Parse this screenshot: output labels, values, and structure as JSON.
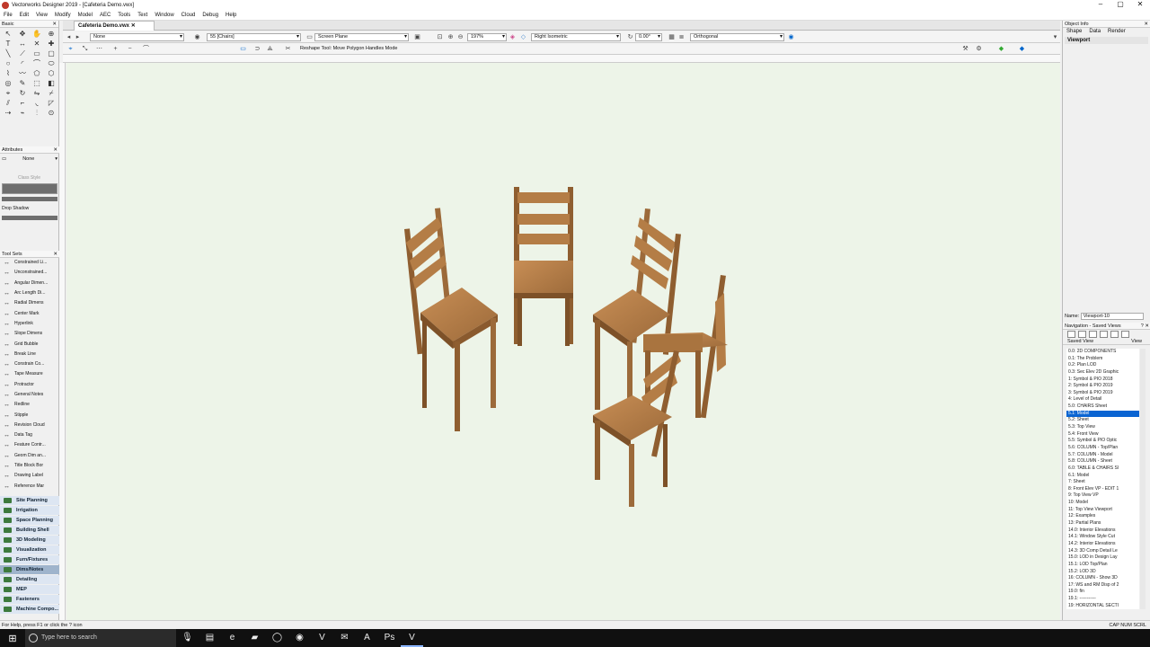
{
  "window": {
    "title": "Vectorworks Designer 2019 - [Cafeteria Demo.vwx]"
  },
  "menu": [
    "File",
    "Edit",
    "View",
    "Modify",
    "Model",
    "AEC",
    "Tools",
    "Text",
    "Window",
    "Cloud",
    "Debug",
    "Help"
  ],
  "document_tab": "Cafeteria Demo.vwx",
  "toolbar": {
    "class": "None",
    "layer": "55 [Chairs]",
    "plane": "Screen Plane",
    "zoom": "197%",
    "view": "Right Isometric",
    "rotation": "0.00°",
    "projection": "Orthogonal",
    "mode_hint": "Reshape Tool: Move Polygon Handles Mode"
  },
  "palettes": {
    "basic_title": "Basic",
    "attributes_title": "Attributes",
    "attributes_fill": "None",
    "class_style": "Class Style",
    "drop_shadow": "Drop Shadow",
    "toolsets_title": "Tool Sets"
  },
  "dims_tools": [
    "Constrained Li...",
    "Unconstrained...",
    "Angular Dimen...",
    "Arc Length Di...",
    "Radial Dimens",
    "Center Mark",
    "Hyperlink",
    "Slope Dimens",
    "Grid Bubble",
    "Break Line",
    "Constrain Co...",
    "Tape Measure",
    "Protractor",
    "General Notes",
    "Redline",
    "Stipple",
    "Revision Cloud",
    "Data Tag",
    "Feature Contr...",
    "Geom Dim an...",
    "Title Block Bor",
    "Drawing Label",
    "Reference Mar"
  ],
  "categories": [
    "Site Planning",
    "Irrigation",
    "Space Planning",
    "Building Shell",
    "3D Modeling",
    "Visualization",
    "Furn/Fixtures",
    "Dims/Notes",
    "Detailing",
    "MEP",
    "Fasteners",
    "Machine Compo..."
  ],
  "selected_category": "Dims/Notes",
  "object_info": {
    "title": "Object Info",
    "tabs": [
      "Shape",
      "Data",
      "Render"
    ],
    "type": "Viewport",
    "name_label": "Name:",
    "name_value": "Viewport-10"
  },
  "navigation": {
    "title": "Navigation - Saved Views",
    "col1": "Saved View",
    "col2": "View",
    "selected": "5.1: Model",
    "items": [
      "0.0: 2D COMPONENTS",
      "0.1: The Problem",
      "0.2: Plan LOD",
      "0.3: Sec Elev 2D Graphic",
      "1: Symbol & PIO 2018",
      "2: Symbol & PIO 2019",
      "3: Symbol & PIO 2019",
      "4: Level of Detail",
      "5.0: CHAIRS Sheet",
      "5.1: Model",
      "5.2: Sheet",
      "5.3: Top View",
      "5.4: Front View",
      "5.5: Symbol & PIO Optic",
      "5.6: COLUMN - Top/Plan",
      "5.7: COLUMN - Model",
      "5.8: COLUMN - Sheet",
      "6.0: TABLE & CHAIRS Sl",
      "6.1: Model",
      "7: Sheet",
      "8: Front Elev VP - EDIT 1",
      "9: Top View VP",
      "10: Model",
      "11: Top View Viewport",
      "12: Examples",
      "13: Partial Plans",
      "14.0: Interior Elevations",
      "14.1: Window Style Cut",
      "14.2: Interior Elevations",
      "14.3: 3D Comp Detail Le",
      "15.0: LOD in Design Lay",
      "15.1: LOD Top/Plan",
      "15.2: LOD 3D",
      "16: COLUMN - Show 3D",
      "17: WS and RM Disp of 2",
      "19.0: fin",
      "19.1: -----------",
      "19: HORIZONTAL SECTI"
    ]
  },
  "status": {
    "help": "For Help, press F1 or click the ? icon",
    "indicators": "CAP NUM SCRL"
  },
  "taskbar": {
    "search_placeholder": "Type here to search"
  },
  "colors": {
    "canvas": "#edf4e8",
    "wood": "#a9743f",
    "selection": "#0a64d2"
  }
}
